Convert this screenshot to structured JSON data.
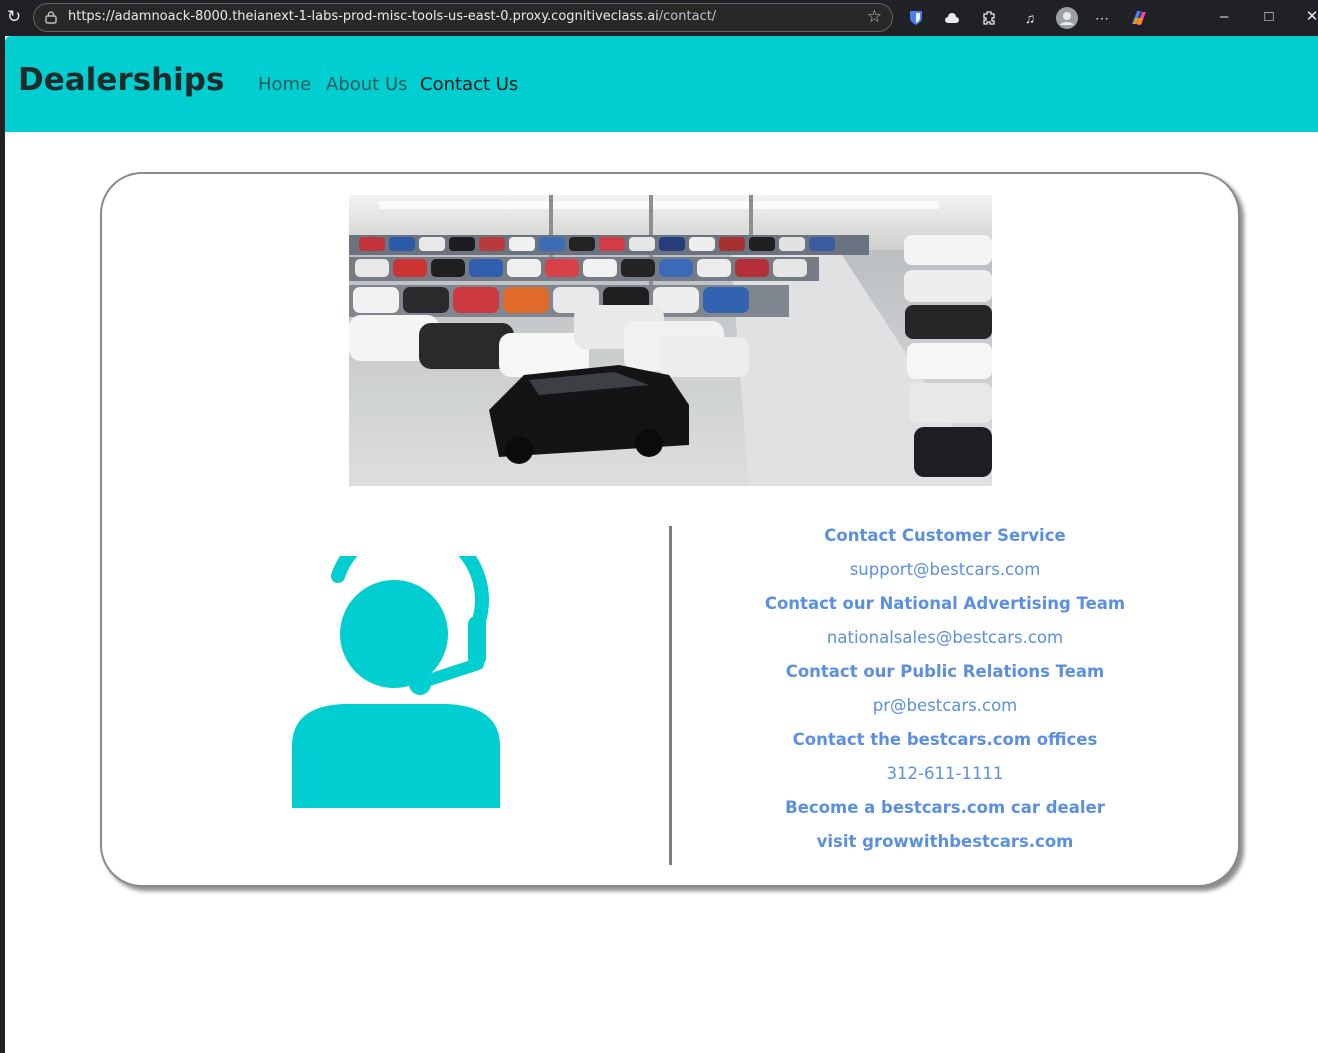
{
  "browser": {
    "url_main": "https://adamnoack-8000.theianext-1-labs-prod-misc-tools-us-east-0.proxy.cognitiveclass.ai",
    "url_path": "/contact/"
  },
  "navbar": {
    "brand": "Dealerships",
    "links": [
      {
        "label": "Home"
      },
      {
        "label": "About Us"
      },
      {
        "label": "Contact Us"
      }
    ]
  },
  "contact": {
    "items": [
      {
        "heading": "Contact Customer Service",
        "value": "support@bestcars.com"
      },
      {
        "heading": "Contact our National Advertising Team",
        "value": "nationalsales@bestcars.com"
      },
      {
        "heading": "Contact our Public Relations Team",
        "value": "pr@bestcars.com"
      },
      {
        "heading": "Contact the bestcars.com offices",
        "value": "312-611-1111"
      },
      {
        "heading": "Become a bestcars.com car dealer",
        "value": "visit growwithbestcars.com"
      }
    ]
  },
  "colors": {
    "navbar": "#00ced1",
    "accent_text": "#5b8fe0",
    "agent_icon": "#00ced1"
  }
}
